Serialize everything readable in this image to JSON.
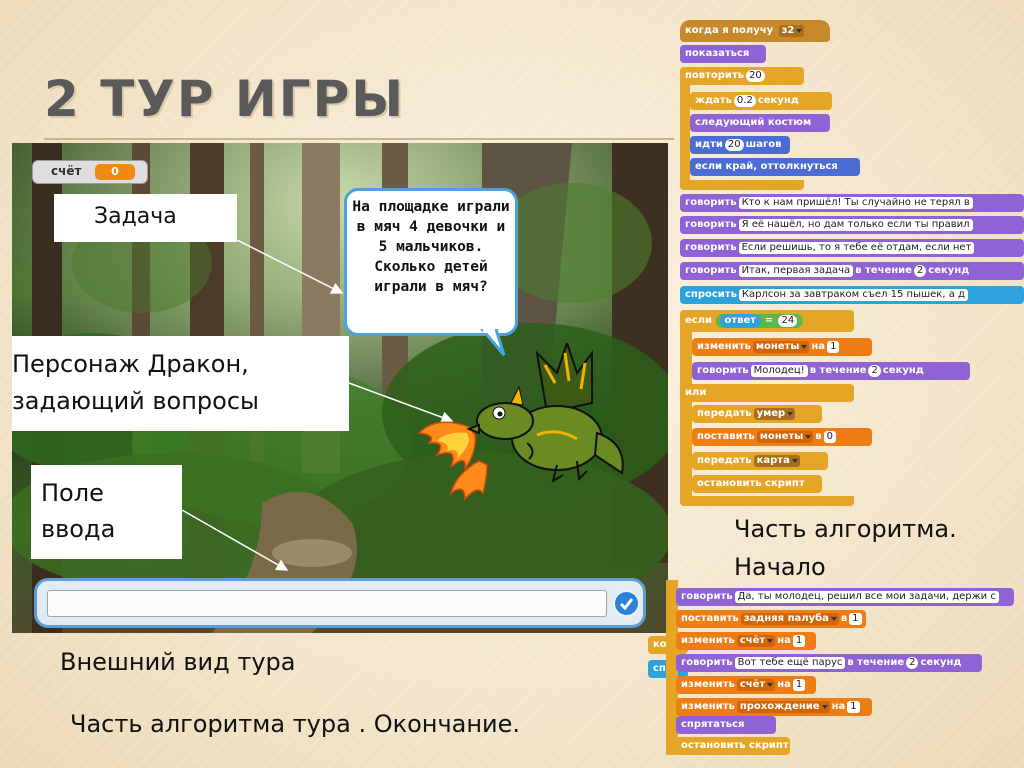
{
  "slide": {
    "title": "2 ТУР ИГРЫ",
    "caption_view": "Внешний вид тура",
    "caption_end": "Часть алгоритма тура . Окончание.",
    "caption_start_line1": "Часть алгоритма.",
    "caption_start_line2": "Начало"
  },
  "stage": {
    "score_label": "счёт",
    "score_value": "0",
    "speech": "На площадке играли в мяч 4 девочки и 5 мальчиков. Сколько детей играли в мяч?",
    "callout_task": "Задача",
    "callout_dragon_line1": "Персонаж Дракон,",
    "callout_dragon_line2": "задающий вопросы",
    "callout_input_line1": "Поле",
    "callout_input_line2": "ввода",
    "answer_value": ""
  },
  "script_start": {
    "hat": "когда я получу",
    "hat_msg": "з2",
    "show": "показаться",
    "repeat": "повторить",
    "repeat_n": "20",
    "wait": "ждать",
    "wait_n": "0.2",
    "wait_unit": "секунд",
    "next_costume": "следующий костюм",
    "move": "идти",
    "move_n": "20",
    "move_unit": "шагов",
    "bounce": "если край, оттолкнуться",
    "say": "говорить",
    "say1": "Кто к нам пришёл! Ты случайно не терял в",
    "say2": "Я её нашёл, но дам только если ты правил",
    "say3": "Если решишь, то я тебе её отдам, если нет",
    "say4": "Итак, первая задача",
    "for_time": "в течение",
    "say4_n": "2",
    "seconds": "секунд",
    "ask": "спросить",
    "ask_text": "Карлсон за завтраком съел 15 пышек, а д",
    "if": "если",
    "answer": "ответ",
    "eq": "=",
    "eq_val": "24",
    "change": "изменить",
    "var_coins": "монеты",
    "by": "на",
    "by_n": "1",
    "say_ok": "Молодец!",
    "say_ok_n": "2",
    "else": "или",
    "broadcast": "передать",
    "msg_dead": "умер",
    "set": "поставить",
    "to": "в",
    "set_n": "0",
    "msg_map": "карта",
    "stop": "остановить скрипт"
  },
  "script_end": {
    "say": "говорить",
    "say_done": "Да, ты молодец, решил все мои задачи, держи с",
    "set": "поставить",
    "var_deck": "задняя палуба",
    "to": "в",
    "set_n": "1",
    "change": "изменить",
    "var_score": "счёт",
    "by": "на",
    "by_n": "1",
    "say_sail": "Вот тебе ещё парус",
    "for_time": "в течение",
    "sail_n": "2",
    "seconds": "секунд",
    "var_pass": "прохождение",
    "hide": "спрятаться",
    "stop": "остановить скрипт",
    "peek1": "ко",
    "peek2": "спр"
  }
}
